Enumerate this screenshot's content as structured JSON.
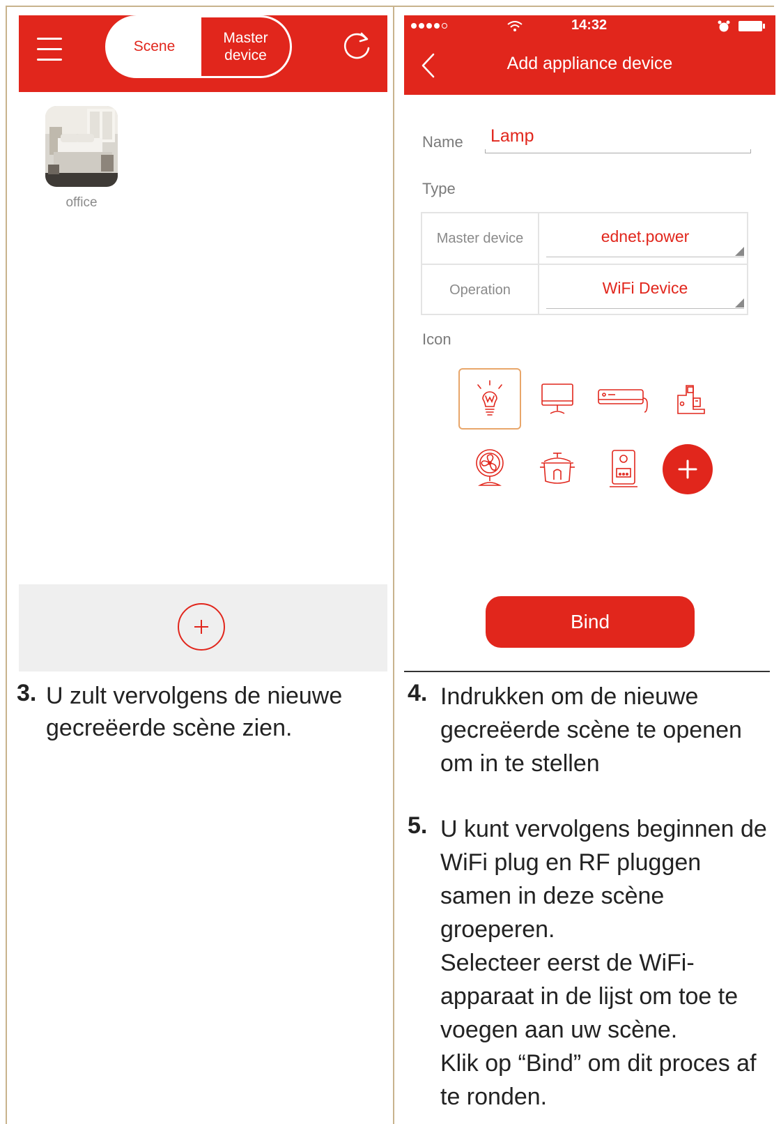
{
  "left_screen": {
    "tabs": {
      "scene": "Scene",
      "master_device_line1": "Master",
      "master_device_line2": "device"
    },
    "scene_item": {
      "label": "office"
    }
  },
  "right_screen": {
    "status": {
      "time": "14:32"
    },
    "title": "Add appliance device",
    "form": {
      "name_label": "Name",
      "name_value": "Lamp",
      "type_label": "Type",
      "master_device_label": "Master device",
      "master_device_value": "ednet.power",
      "operation_label": "Operation",
      "operation_value": "WiFi Device",
      "icon_label": "Icon"
    },
    "icons": [
      "lamp-icon",
      "monitor-icon",
      "air-conditioner-icon",
      "coffee-machine-icon",
      "fan-icon",
      "rice-cooker-icon",
      "speaker-icon"
    ],
    "bind_label": "Bind"
  },
  "instructions": {
    "step3_num": "3.",
    "step3_text": "U zult vervolgens de nieuwe gecreëerde scène zien.",
    "step4_num": "4.",
    "step4_text": "Indrukken om de nieuwe gecreëerde scène te openen om in te stellen",
    "step5_num": "5.",
    "step5_text_a": "U kunt vervolgens beginnen de WiFi plug en RF pluggen samen in deze scène groeperen.",
    "step5_text_b": "Selecteer eerst de WiFi-apparaat in de lijst om toe te voegen aan uw scène.",
    "step5_text_c": "Klik op “Bind” om dit proces af te ronden."
  },
  "colors": {
    "accent": "#e1261c",
    "border": "#c8b38d",
    "selected_icon_border": "#e8a66a"
  }
}
